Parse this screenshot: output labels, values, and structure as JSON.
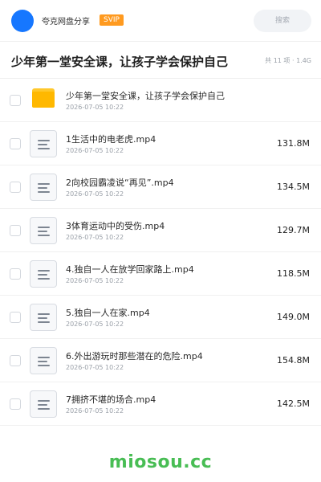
{
  "header": {
    "account_name": "夸克网盘分享",
    "badge": "SVIP",
    "search_placeholder": "搜索",
    "avatar_color": "#1677ff"
  },
  "folder": {
    "title": "少年第一堂安全课，让孩子学会保护自己",
    "meta": "共 11 项 · 1.4G"
  },
  "files": [
    {
      "type": "folder",
      "name": "少年第一堂安全课，让孩子学会保护自己",
      "date": "2026-07-05 10:22",
      "size": ""
    },
    {
      "type": "video",
      "name": "1生活中的电老虎.mp4",
      "date": "2026-07-05 10:22",
      "size": "131.8M"
    },
    {
      "type": "video",
      "name": "2向校园霸凌说“再见”.mp4",
      "date": "2026-07-05 10:22",
      "size": "134.5M"
    },
    {
      "type": "video",
      "name": "3体育运动中的受伤.mp4",
      "date": "2026-07-05 10:22",
      "size": "129.7M"
    },
    {
      "type": "video",
      "name": "4.独自一人在放学回家路上.mp4",
      "date": "2026-07-05 10:22",
      "size": "118.5M"
    },
    {
      "type": "video",
      "name": "5.独自一人在家.mp4",
      "date": "2026-07-05 10:22",
      "size": "149.0M"
    },
    {
      "type": "video",
      "name": "6.外出游玩时那些潜在的危险.mp4",
      "date": "2026-07-05 10:22",
      "size": "154.8M"
    },
    {
      "type": "video",
      "name": "7拥挤不堪的场合.mp4",
      "date": "2026-07-05 10:22",
      "size": "142.5M"
    }
  ],
  "watermark": "miosou.cc",
  "colors": {
    "accent": "#1677ff",
    "badge": "#ff9a1f",
    "folder": "#ffb800",
    "watermark": "#48bd54"
  }
}
